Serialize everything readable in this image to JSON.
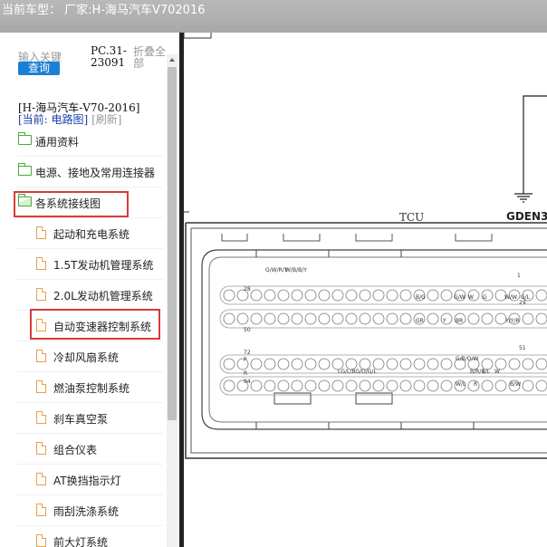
{
  "window": {
    "title": "当前车型： 厂家:H-海马汽车V702016"
  },
  "search": {
    "label": "输入关键",
    "button": "查询",
    "code": "PC.31-23091",
    "fold_all": "折叠全部"
  },
  "breadcrumb": {
    "model": "[H-海马汽车-V70-2016]",
    "current": "[当前: 电路图]",
    "refresh": "[刷新]"
  },
  "tree": {
    "folders": [
      {
        "label": "通用资料"
      },
      {
        "label": "电源、接地及常用连接器"
      },
      {
        "label": "各系统接线图"
      }
    ],
    "items": [
      {
        "label": "起动和充电系统"
      },
      {
        "label": "1.5T发动机管理系统"
      },
      {
        "label": "2.0L发动机管理系统"
      },
      {
        "label": "自动变速器控制系统"
      },
      {
        "label": "冷却风扇系统"
      },
      {
        "label": "燃油泵控制系统"
      },
      {
        "label": "刹车真空泵"
      },
      {
        "label": "组合仪表"
      },
      {
        "label": "AT换挡指示灯"
      },
      {
        "label": "雨刮洗涤系统"
      },
      {
        "label": "前大灯系统"
      }
    ]
  },
  "diagram": {
    "module_label": "TCU",
    "ground_label": "GDEN3",
    "pin_rows": [
      "28",
      "50",
      "72",
      "94",
      "P",
      "R",
      "1",
      "29",
      "51"
    ],
    "wire_codes": [
      "B/G",
      "G/W",
      "W",
      "G",
      "W/W",
      "G/L",
      "GR",
      "Y",
      "BR",
      "Y/Y/R",
      "G/W/R/Y",
      "W/B/B/Y",
      "G/B/O/W",
      "LG/L/BG/O/G/L",
      "B/R/B/L",
      "L",
      "W",
      "R",
      "W/L",
      "B/W"
    ],
    "colors": {
      "highlight": "#d93a3a",
      "button": "#1a7fd6",
      "folder": "#4aa83e",
      "file": "#e8a04a"
    }
  }
}
